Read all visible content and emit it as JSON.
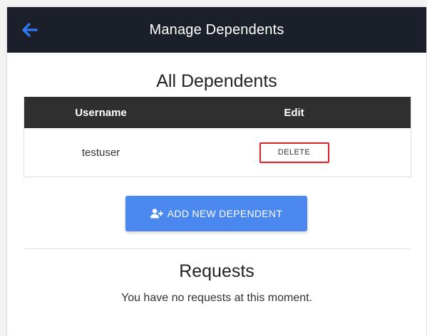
{
  "header": {
    "title": "Manage Dependents",
    "back_icon": "arrow-left-icon",
    "back_color": "#2f7cf6",
    "bar_color": "#1b1f2a"
  },
  "dependents": {
    "title": "All Dependents",
    "columns": [
      "Username",
      "Edit"
    ],
    "rows": [
      {
        "username": "testuser",
        "action_label": "DELETE"
      }
    ],
    "delete_border_color": "#d9242f"
  },
  "add_button": {
    "label": "ADD NEW DEPENDENT",
    "icon": "user-plus-icon",
    "color": "#4a87ef"
  },
  "requests": {
    "title": "Requests",
    "empty_message": "You have no requests at this moment."
  }
}
